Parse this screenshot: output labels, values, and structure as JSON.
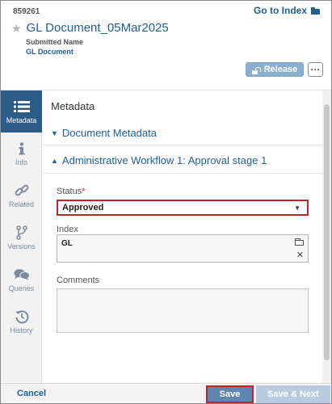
{
  "header": {
    "doc_id": "859261",
    "go_to_index": "Go to Index",
    "title": "GL Document_05Mar2025",
    "submitted_label": "Submitted Name",
    "submitted_value": "GL Document",
    "release_label": "Release",
    "more_label": "···"
  },
  "rail": {
    "items": [
      {
        "label": "Metadata",
        "icon": "list-icon",
        "active": true
      },
      {
        "label": "Info",
        "icon": "info-icon"
      },
      {
        "label": "Related",
        "icon": "link-icon"
      },
      {
        "label": "Versions",
        "icon": "branch-icon"
      },
      {
        "label": "Queries",
        "icon": "chat-icon"
      },
      {
        "label": "History",
        "icon": "history-icon"
      }
    ]
  },
  "main": {
    "title": "Metadata",
    "document_metadata": "Document Metadata",
    "workflow_section": "Administrative Workflow 1: Approval stage 1",
    "status_label": "Status",
    "status_required": "*",
    "status_value": "Approved",
    "index_label": "Index",
    "index_value": "GL",
    "comments_label": "Comments"
  },
  "footer": {
    "cancel": "Cancel",
    "save": "Save",
    "save_next": "Save & Next"
  },
  "colors": {
    "accent": "#1f5f94",
    "rail_active": "#2c5b88",
    "highlight_border": "#c0232b"
  }
}
